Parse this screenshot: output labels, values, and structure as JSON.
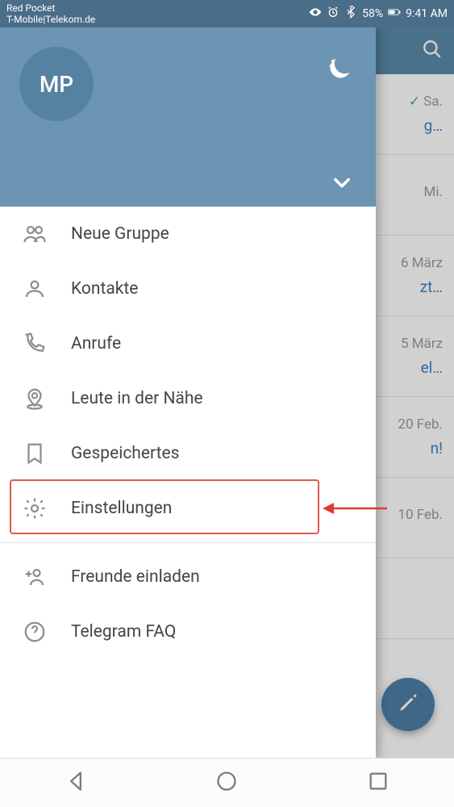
{
  "statusbar": {
    "carrier1": "Red Pocket",
    "carrier2": "T-Mobile|Telekom.de",
    "battery": "58%",
    "time": "9:41 AM"
  },
  "drawer": {
    "avatar_initials": "MP",
    "items": [
      {
        "label": "Neue Gruppe"
      },
      {
        "label": "Kontakte"
      },
      {
        "label": "Anrufe"
      },
      {
        "label": "Leute in der Nähe"
      },
      {
        "label": "Gespeichertes"
      },
      {
        "label": "Einstellungen"
      },
      {
        "label": "Freunde einladen"
      },
      {
        "label": "Telegram FAQ"
      }
    ]
  },
  "chatlist": {
    "rows": [
      {
        "when": "Sa.",
        "snip": "g…",
        "sent": true
      },
      {
        "when": "Mi.",
        "snip": "",
        "sent": false
      },
      {
        "when": "6 März",
        "snip": "zt…",
        "sent": false
      },
      {
        "when": "5 März",
        "snip": "el…",
        "sent": false
      },
      {
        "when": "20 Feb.",
        "snip": "n!",
        "sent": false
      },
      {
        "when": "10 Feb.",
        "snip": "",
        "sent": false
      },
      {
        "when": "",
        "snip": "",
        "sent": false
      }
    ]
  }
}
